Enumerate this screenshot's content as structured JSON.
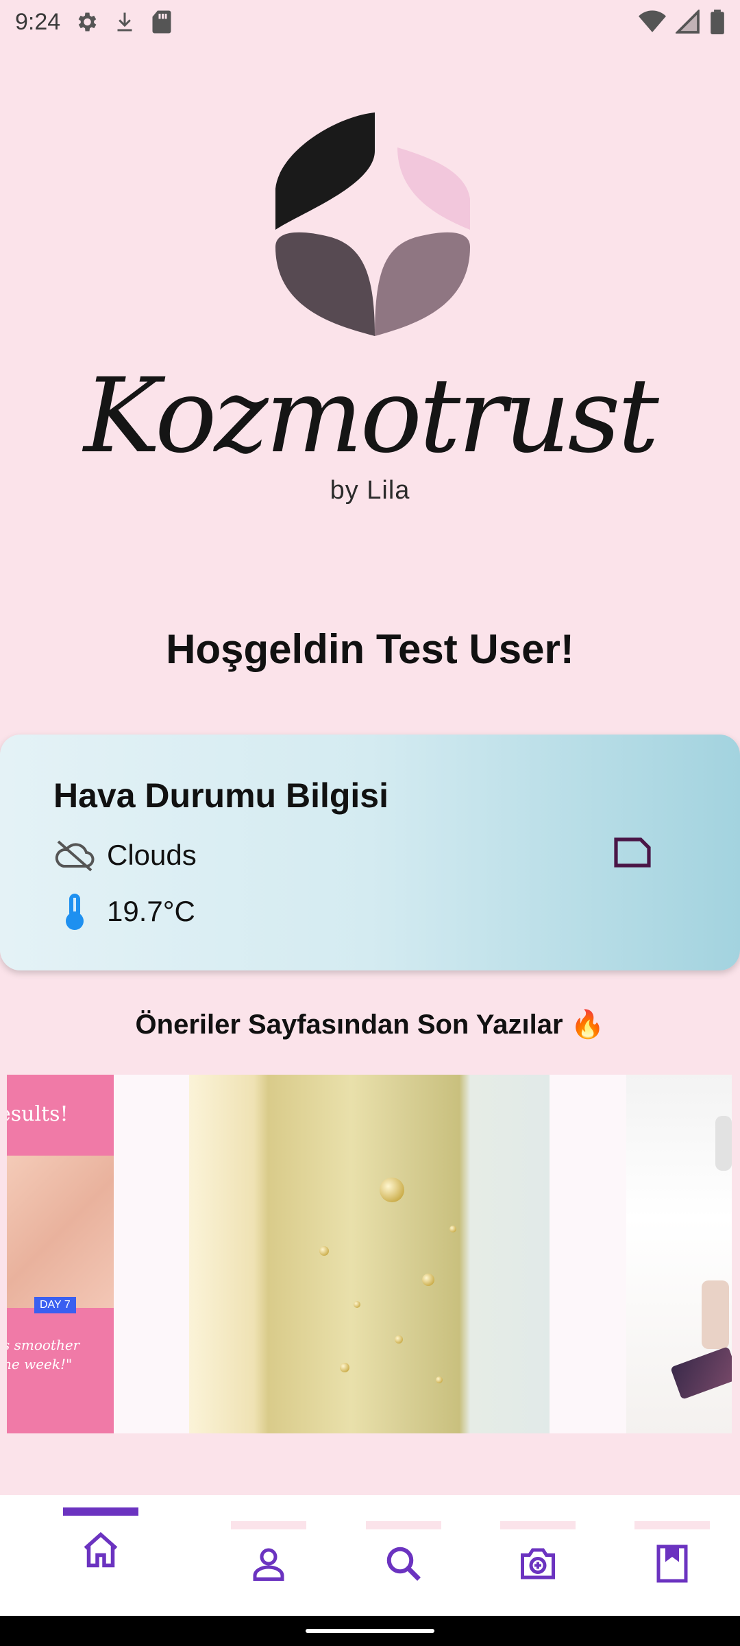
{
  "status_bar": {
    "time": "9:24",
    "left_icons": [
      "gear-icon",
      "download-icon",
      "sd-card-icon"
    ],
    "right_icons": [
      "wifi-icon",
      "signal-icon",
      "battery-icon"
    ]
  },
  "brand": {
    "name": "Kozmotrust",
    "subtitle": "by Lila",
    "logo_colors": [
      "#1a1a1a",
      "#f2c7dc",
      "#574a52",
      "#8f7682"
    ]
  },
  "welcome_text": "Hoşgeldin Test User!",
  "weather": {
    "title": "Hava Durumu Bilgisi",
    "condition": "Clouds",
    "temperature": "19.7°C",
    "icons": [
      "cloud-off-icon",
      "thermometer-icon",
      "note-icon"
    ]
  },
  "recent_posts": {
    "title": "Öneriler Sayfasından Son Yazılar 🔥",
    "items": [
      {
        "id": "post-1",
        "caption": "esults!",
        "badge": "DAY 7",
        "quote": "s smoother\nne week!\""
      },
      {
        "id": "post-2"
      },
      {
        "id": "post-3"
      }
    ]
  },
  "bottom_nav": {
    "items": [
      {
        "name": "home",
        "icon": "home-icon",
        "active": true
      },
      {
        "name": "profile",
        "icon": "person-icon",
        "active": false
      },
      {
        "name": "search",
        "icon": "search-icon",
        "active": false
      },
      {
        "name": "camera",
        "icon": "camera-icon",
        "active": false
      },
      {
        "name": "bookmarks",
        "icon": "bookmark-icon",
        "active": false
      }
    ],
    "accent_color": "#6b33c0"
  },
  "colors": {
    "background": "#fbe3ea",
    "weather_gradient_start": "#e4f2f6",
    "weather_gradient_end": "#a3d3df",
    "nav_indicator_inactive": "#fbe3ea"
  }
}
